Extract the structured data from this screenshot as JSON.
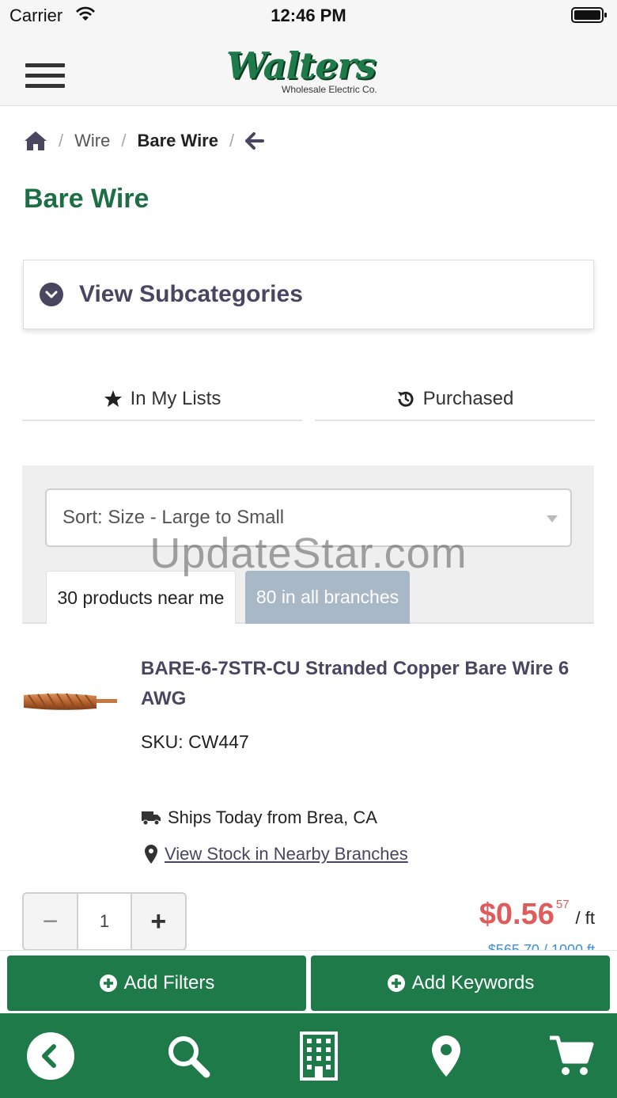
{
  "status_bar": {
    "carrier": "Carrier",
    "time": "12:46 PM"
  },
  "header": {
    "logo_script": "Walters",
    "logo_sub": "Wholesale Electric Co."
  },
  "breadcrumb": {
    "items": [
      "Wire",
      "Bare Wire"
    ]
  },
  "page": {
    "title": "Bare Wire"
  },
  "subcategories": {
    "label": "View Subcategories"
  },
  "filter_tabs": {
    "in_my_lists": "In My Lists",
    "purchased": "Purchased"
  },
  "sort": {
    "selected": "Sort: Size - Large to Small"
  },
  "stock_tabs": {
    "near_me": "30 products near me",
    "all_branches": "80 in all branches"
  },
  "watermark": "UpdateStar.com",
  "product": {
    "title": "BARE-6-7STR-CU Stranded Copper Bare Wire 6 AWG",
    "sku": "SKU: CW447",
    "ships": "Ships Today from Brea, CA",
    "stock_link": "View Stock in Nearby Branches",
    "quantity": "1",
    "price_dollars": "$0.56",
    "price_cents": "57",
    "price_unit": "/ ft",
    "price_alt": "$565.70 / 1000 ft"
  },
  "actions": {
    "add_filters": "Add Filters",
    "add_keywords": "Add Keywords"
  },
  "colors": {
    "brand_green": "#1f7a4a",
    "title_green": "#1e6e45",
    "price_red": "#e05c5c",
    "link_purple": "#4a4560"
  }
}
